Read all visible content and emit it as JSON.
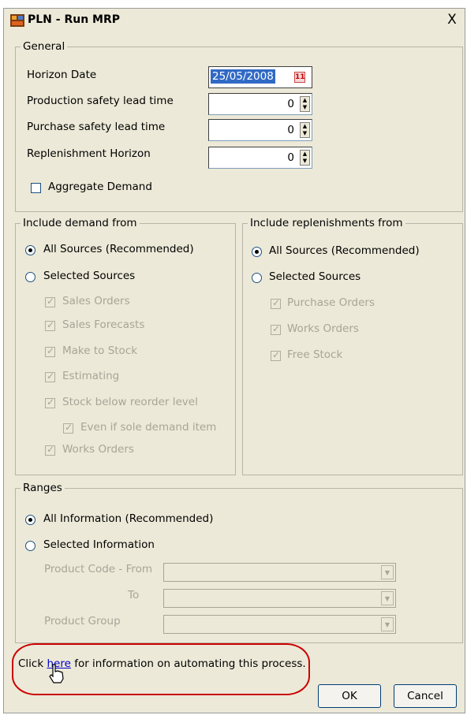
{
  "window": {
    "title": "PLN - Run MRP",
    "close_label": "X"
  },
  "general": {
    "legend": "General",
    "horizon_date_label": "Horizon Date",
    "horizon_date_value": "25/05/2008",
    "production_lead_label": "Production safety lead time",
    "production_lead_value": "0",
    "purchase_lead_label": "Purchase safety lead time",
    "purchase_lead_value": "0",
    "replenishment_label": "Replenishment Horizon",
    "replenishment_value": "0",
    "aggregate_label": "Aggregate Demand"
  },
  "demand": {
    "legend": "Include demand from",
    "all_sources": "All Sources (Recommended)",
    "selected_sources": "Selected Sources",
    "items": [
      "Sales Orders",
      "Sales Forecasts",
      "Make to Stock",
      "Estimating",
      "Stock below reorder level",
      "Even if sole demand item",
      "Works Orders"
    ]
  },
  "replenishment": {
    "legend": "Include replenishments from",
    "all_sources": "All Sources (Recommended)",
    "selected_sources": "Selected Sources",
    "items": [
      "Purchase Orders",
      "Works Orders",
      "Free Stock"
    ]
  },
  "ranges": {
    "legend": "Ranges",
    "all_info": "All Information (Recommended)",
    "selected_info": "Selected Information",
    "product_code_from": "Product Code -  From",
    "to_label": "To",
    "product_group": "Product Group"
  },
  "footer": {
    "click_text": "Click",
    "here_link": "here",
    "rest_text": "for information on automating this process.",
    "ok_label": "OK",
    "cancel_label": "Cancel"
  }
}
